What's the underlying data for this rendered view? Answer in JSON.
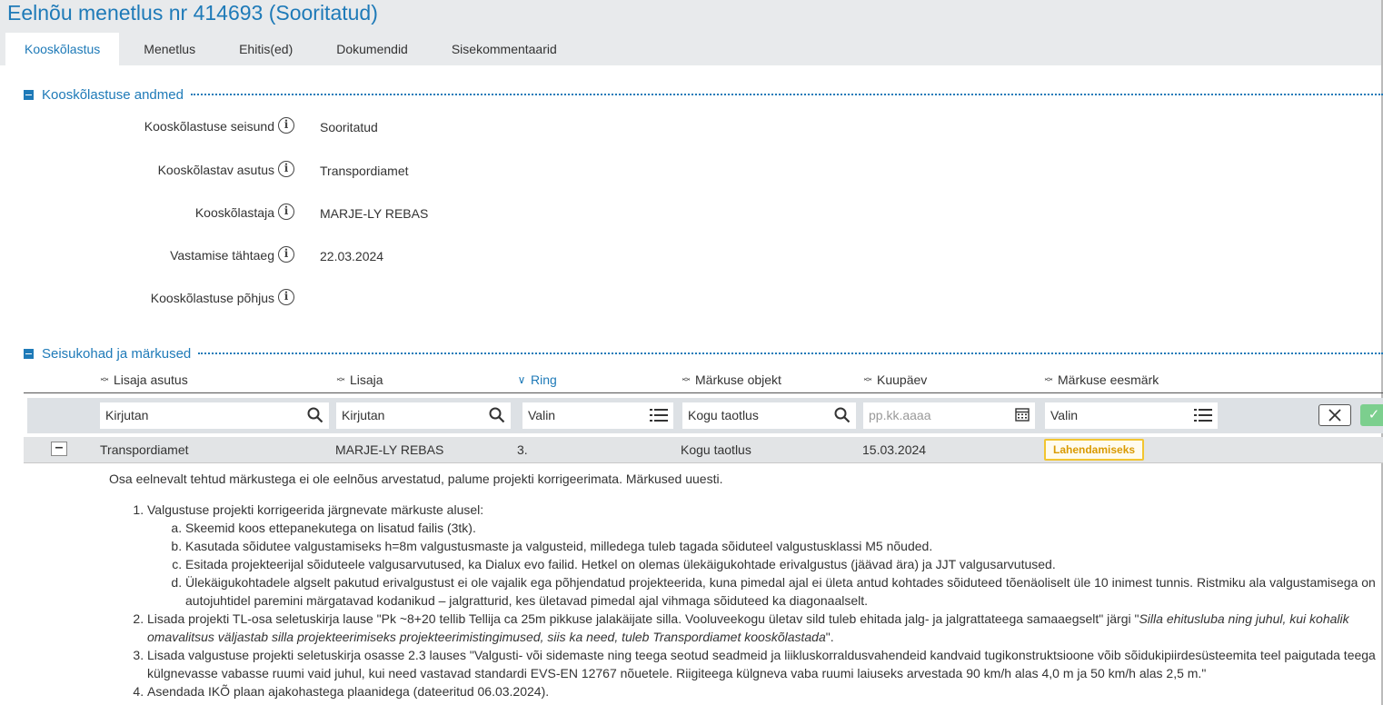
{
  "page": {
    "title": "Eelnõu menetlus nr 414693 (Sooritatud)"
  },
  "tabs": [
    {
      "label": "Kooskõlastus"
    },
    {
      "label": "Menetlus"
    },
    {
      "label": "Ehitis(ed)"
    },
    {
      "label": "Dokumendid"
    },
    {
      "label": "Sisekommentaarid"
    }
  ],
  "section1": {
    "title": "Kooskõlastuse andmed",
    "fields": [
      {
        "label": "Kooskõlastuse seisund",
        "value": "Sooritatud"
      },
      {
        "label": "Kooskõlastav asutus",
        "value": "Transpordiamet"
      },
      {
        "label": "Kooskõlastaja",
        "value": "MARJE-LY REBAS"
      },
      {
        "label": "Vastamise tähtaeg",
        "value": "22.03.2024"
      },
      {
        "label": "Kooskõlastuse põhjus",
        "value": ""
      }
    ]
  },
  "section2": {
    "title": "Seisukohad ja märkused",
    "columns": [
      "Lisaja asutus",
      "Lisaja",
      "Ring",
      "Märkuse objekt",
      "Kuupäev",
      "Märkuse eesmärk"
    ],
    "filters": {
      "lisaja_asutus": "Kirjutan",
      "lisaja": "Kirjutan",
      "ring": "Valin",
      "objekt": "Kogu taotlus",
      "kuupaev_placeholder": "pp.kk.aaaa",
      "eesmark": "Valin"
    },
    "row": {
      "asutus": "Transpordiamet",
      "lisaja": "MARJE-LY REBAS",
      "ring": "3.",
      "objekt": "Kogu taotlus",
      "kuupaev": "15.03.2024",
      "eesmark": "Lahendamiseks"
    },
    "comment": {
      "intro": "Osa eelnevalt tehtud märkustega ei ole eelnõus arvestatud, palume projekti korrigeerimata. Märkused uuesti.",
      "item1": "Valgustuse projekti korrigeerida järgnevate märkuste alusel:",
      "item1a": "Skeemid koos ettepanekutega on lisatud failis (3tk).",
      "item1b": "Kasutada sõidutee valgustamiseks h=8m valgustusmaste ja valgusteid, milledega tuleb tagada sõiduteel valgustusklassi M5 nõuded.",
      "item1c": "Esitada projekteerijal sõiduteele valgusarvutused, ka Dialux evo failid. Hetkel on olemas ülekäigukohtade erivalgustus (jäävad ära) ja JJT valgusarvutused.",
      "item1d": "Ülekäigukohtadele algselt pakutud erivalgustust ei ole vajalik ega põhjendatud projekteerida, kuna pimedal ajal ei ületa antud kohtades sõiduteed tõenäoliselt üle 10 inimest tunnis. Ristmiku ala valgustamisega on autojuhtidel paremini märgatavad kodanikud – jalgratturid, kes ületavad pimedal ajal vihmaga sõiduteed ka diagonaalselt.",
      "item2_pre": "Lisada projekti TL-osa seletuskirja lause \"Pk ~8+20 tellib Tellija ca 25m pikkuse jalakäijate silla. Vooluveekogu ületav sild tuleb ehitada jalg- ja jalgrattateega samaaegselt\" järgi \"",
      "item2_em": "Silla ehitusluba ning juhul, kui kohalik omavalitsus väljastab silla projekteerimiseks projekteerimistingimused, siis ka need, tuleb Transpordiamet kooskõlastada",
      "item2_post": "\".",
      "item3": "Lisada valgustuse projekti seletuskirja osasse 2.3 lauses \"Valgusti- või sidemaste ning teega seotud seadmeid ja liikluskorraldusvahendeid kandvaid tugikonstruktsioone võib sõidukipiirdesüsteemita teel paigutada teega külgnevasse vabasse ruumi vaid juhul, kui need vastavad standardi EVS-EN 12767 nõuetele. Riigiteega külgneva vaba ruumi laiuseks arvestada 90 km/h alas 4,0 m ja 50 km/h alas 2,5 m.\"",
      "item4": "Asendada IKÕ plaan ajakohastega plaanidega (dateeritud 06.03.2024)."
    }
  }
}
